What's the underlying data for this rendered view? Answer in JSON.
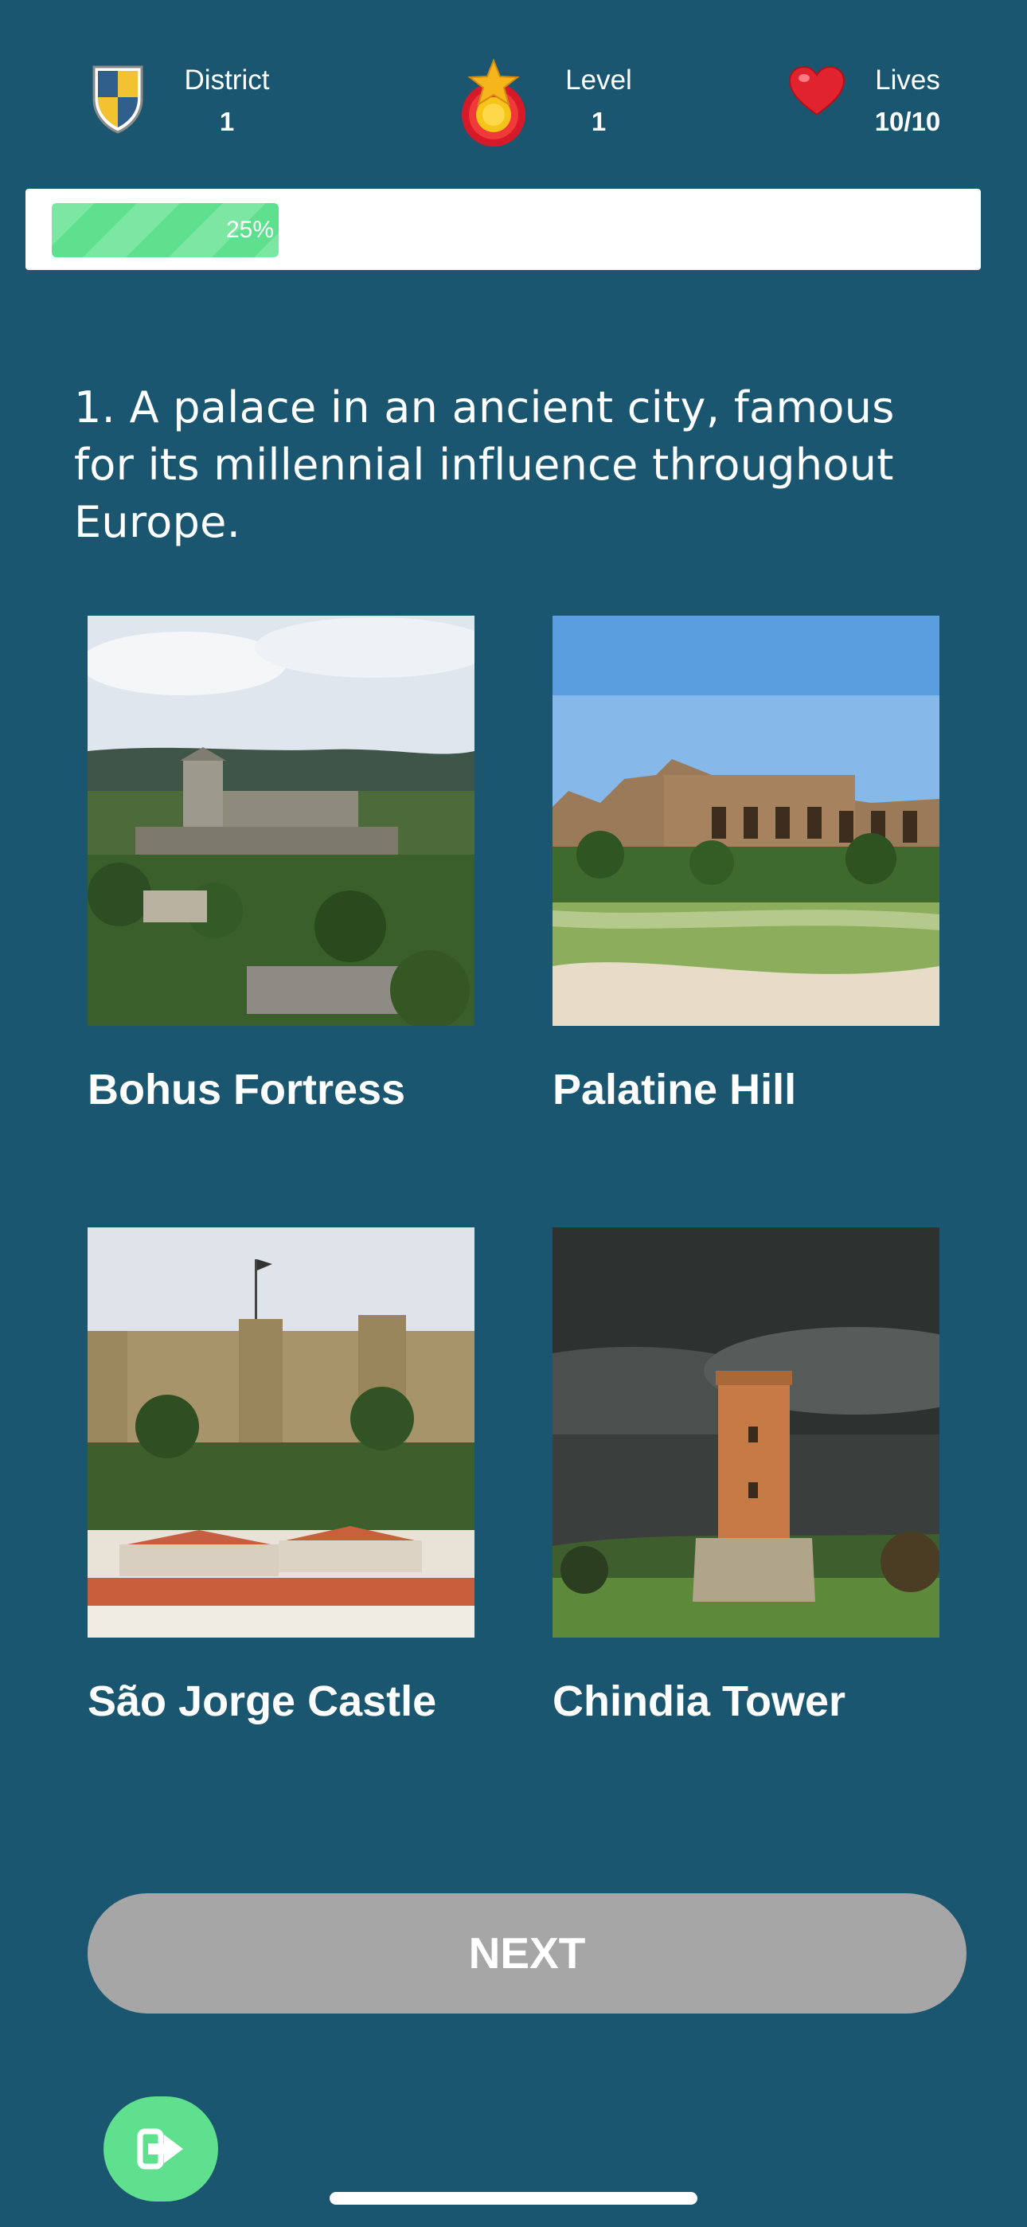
{
  "header": {
    "district": {
      "label": "District",
      "value": "1",
      "icon": "shield-icon"
    },
    "level": {
      "label": "Level",
      "value": "1",
      "icon": "star-medal-icon"
    },
    "lives": {
      "label": "Lives",
      "value": "10/10",
      "icon": "heart-icon"
    }
  },
  "progress": {
    "percent": 25,
    "label": "25%"
  },
  "question": {
    "text": "1. A palace in an ancient city, famous for its millennial influence throughout Europe."
  },
  "options": [
    {
      "label": "Bohus Fortress",
      "image": "fortress-photo"
    },
    {
      "label": "Palatine Hill",
      "image": "roman-ruins-photo"
    },
    {
      "label": "São Jorge Castle",
      "image": "castle-walls-photo"
    },
    {
      "label": "Chindia Tower",
      "image": "brick-tower-photo"
    }
  ],
  "actions": {
    "next_label": "NEXT",
    "exit_icon": "exit-icon"
  },
  "colors": {
    "background": "#1b5670",
    "accent_green": "#5fe08f",
    "button_disabled": "#a6a6a6"
  }
}
